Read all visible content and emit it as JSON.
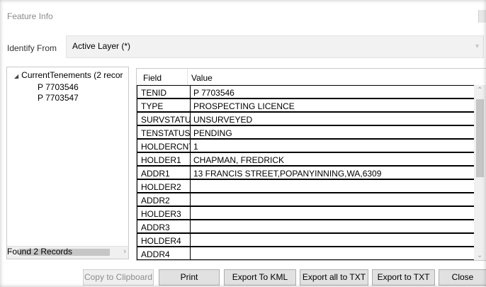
{
  "window": {
    "title": "Feature Info"
  },
  "identify": {
    "label": "Identify From",
    "value": "Active Layer (*)"
  },
  "tree": {
    "root_label": "CurrentTenements (2 recor",
    "children": [
      "P 7703546",
      "P 7703547"
    ]
  },
  "status": {
    "found": "Found 2 Records"
  },
  "grid": {
    "headers": {
      "field": "Field",
      "value": "Value"
    },
    "rows": [
      {
        "field": "TENID",
        "value": "P 7703546"
      },
      {
        "field": "TYPE",
        "value": "PROSPECTING LICENCE"
      },
      {
        "field": "SURVSTATUS",
        "value": "UNSURVEYED"
      },
      {
        "field": "TENSTATUS",
        "value": "PENDING"
      },
      {
        "field": "HOLDERCNT",
        "value": "1"
      },
      {
        "field": "HOLDER1",
        "value": "CHAPMAN, FREDRICK"
      },
      {
        "field": "ADDR1",
        "value": "13 FRANCIS STREET,POPANYINNING,WA,6309"
      },
      {
        "field": "HOLDER2",
        "value": ""
      },
      {
        "field": "ADDR2",
        "value": ""
      },
      {
        "field": "HOLDER3",
        "value": ""
      },
      {
        "field": "ADDR3",
        "value": ""
      },
      {
        "field": "HOLDER4",
        "value": ""
      },
      {
        "field": "ADDR4",
        "value": ""
      }
    ]
  },
  "buttons": {
    "copy": "Copy to Clipboard",
    "print": "Print",
    "export_kml": "Export To KML",
    "export_all_txt": "Export all to TXT",
    "export_txt": "Export to TXT",
    "close": "Close"
  }
}
